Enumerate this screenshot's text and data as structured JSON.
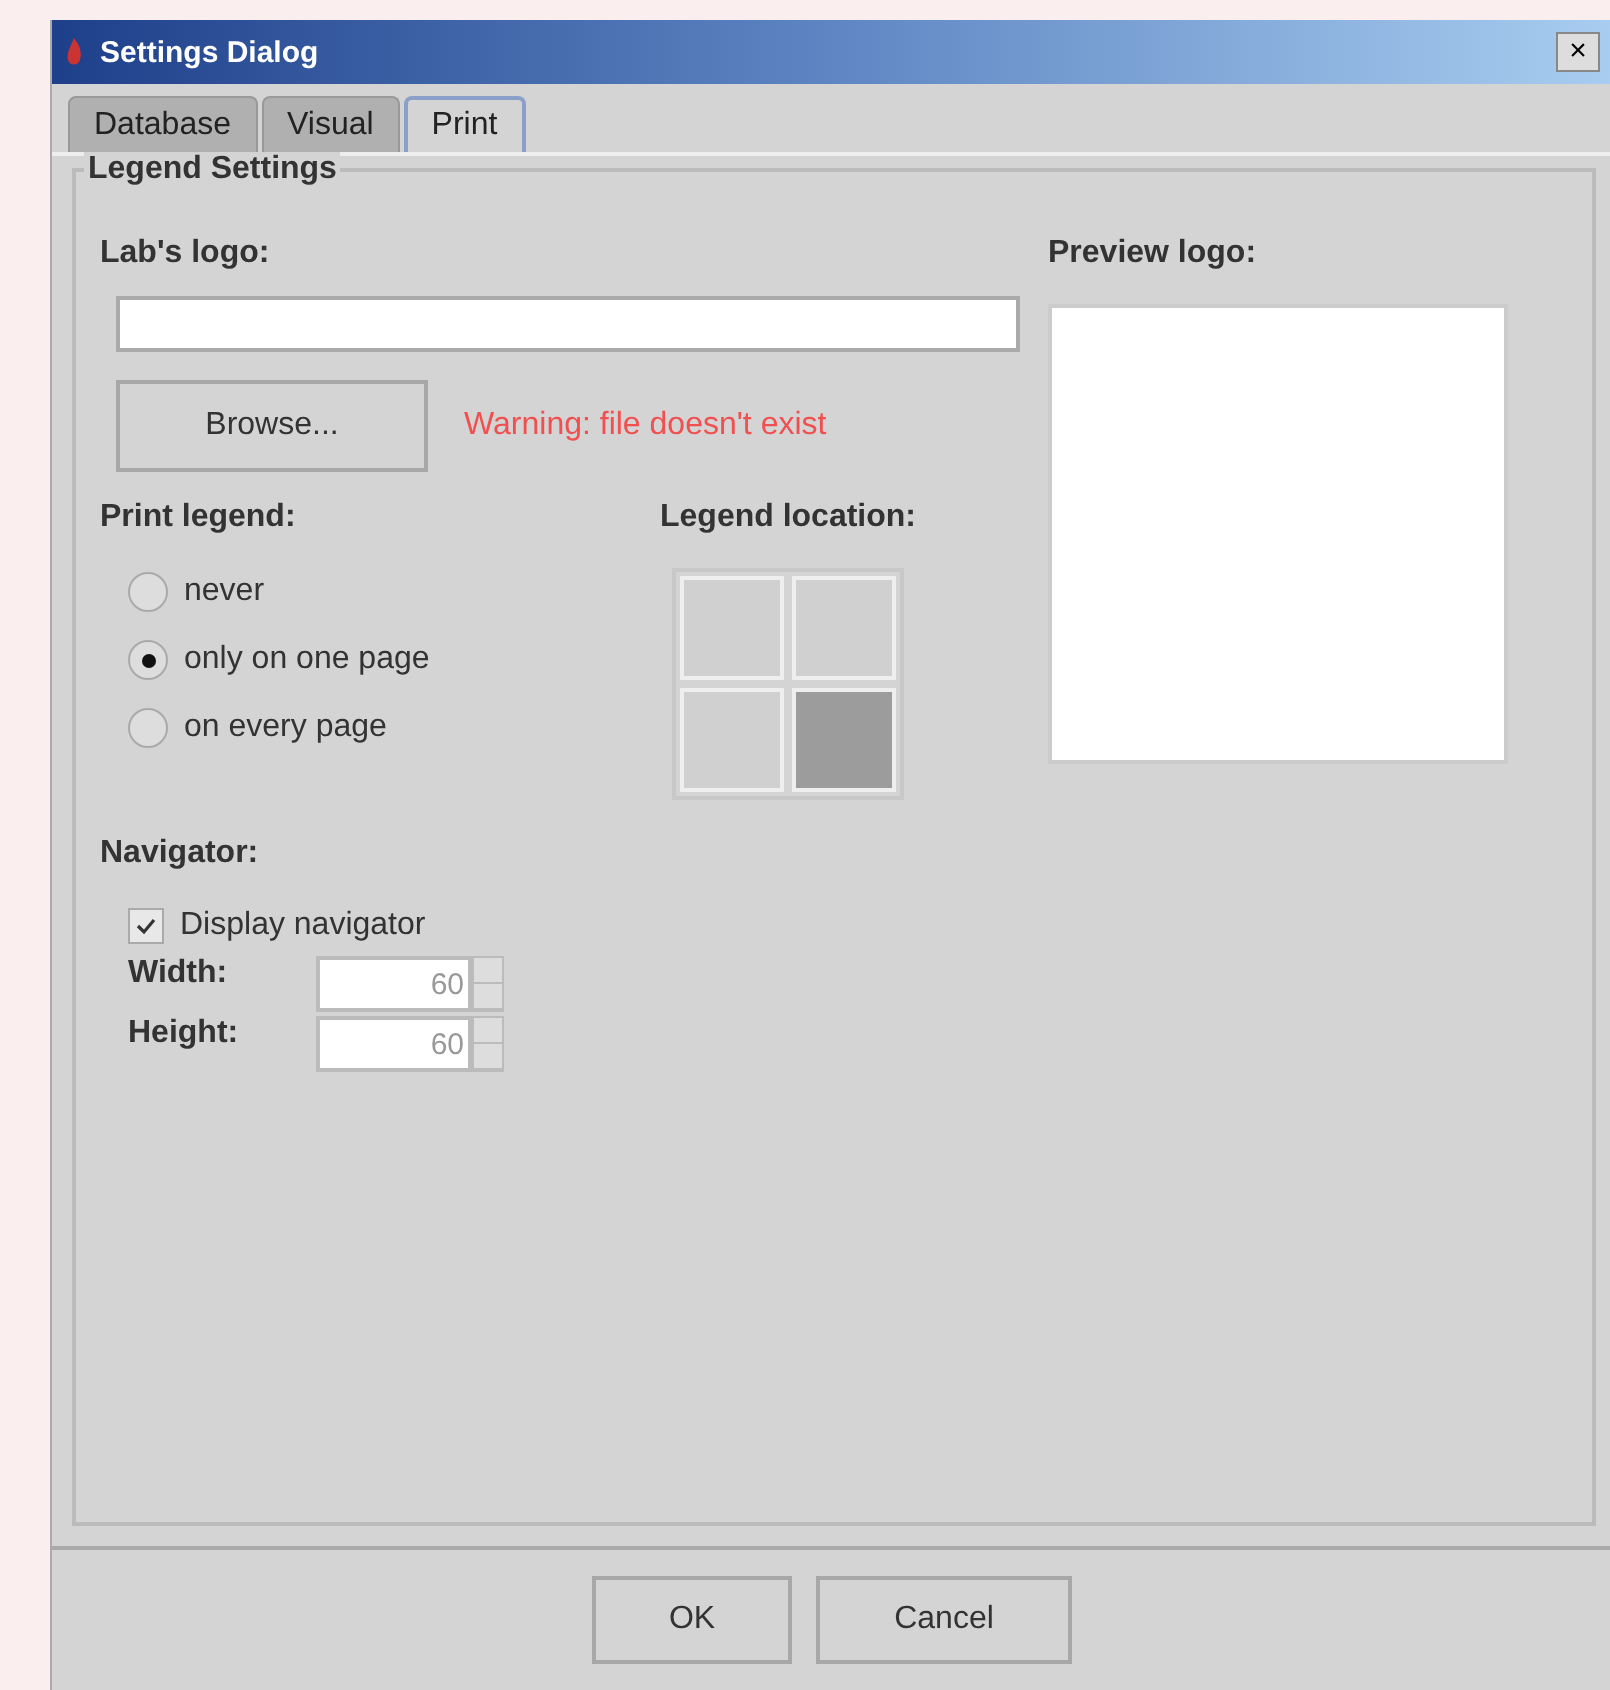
{
  "window": {
    "title": "Settings Dialog",
    "close": "×"
  },
  "tabs": [
    {
      "label": "Database",
      "selected": false
    },
    {
      "label": "Visual",
      "selected": false
    },
    {
      "label": "Print",
      "selected": true
    }
  ],
  "group": {
    "title": "Legend Settings"
  },
  "logo": {
    "label": "Lab's logo:",
    "browse": "Browse...",
    "warning": "Warning: file doesn't exist"
  },
  "preview": {
    "label": "Preview logo:"
  },
  "print_legend": {
    "label": "Print legend:",
    "options": [
      {
        "label": "never",
        "selected": false
      },
      {
        "label": "only on one page",
        "selected": true
      },
      {
        "label": "on every page",
        "selected": false
      }
    ]
  },
  "legend_location": {
    "label": "Legend location:",
    "cells": [
      {
        "selected": false
      },
      {
        "selected": false
      },
      {
        "selected": false
      },
      {
        "selected": true
      }
    ]
  },
  "navigator": {
    "label": "Navigator:",
    "display": {
      "label": "Display navigator",
      "checked": true
    },
    "fields": [
      {
        "label": "Width:",
        "value": "60"
      },
      {
        "label": "Height:",
        "value": "60"
      }
    ]
  },
  "buttons": [
    "OK",
    "Cancel"
  ]
}
